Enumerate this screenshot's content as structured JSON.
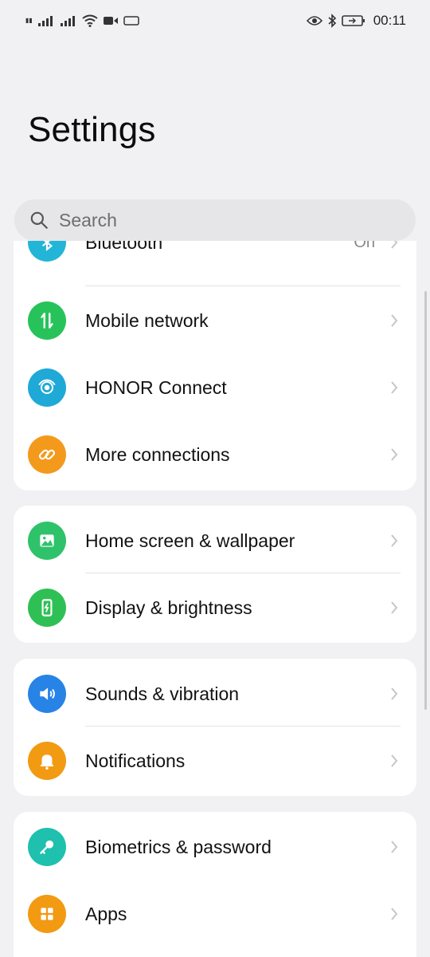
{
  "status_bar": {
    "time": "00:11"
  },
  "page": {
    "title": "Settings"
  },
  "search": {
    "placeholder": "Search"
  },
  "groups": [
    {
      "items": [
        {
          "label": "Bluetooth",
          "value": "On",
          "icon": "bluetooth-icon",
          "color": "#22b5d8"
        },
        {
          "label": "Mobile network",
          "icon": "mobile-data-icon",
          "color": "#27c35a"
        },
        {
          "label": "HONOR Connect",
          "icon": "connect-icon",
          "color": "#1fa9d6"
        },
        {
          "label": "More connections",
          "icon": "link-icon",
          "color": "#f39a1c"
        }
      ]
    },
    {
      "items": [
        {
          "label": "Home screen & wallpaper",
          "icon": "image-icon",
          "color": "#2ec36a"
        },
        {
          "label": "Display & brightness",
          "icon": "phone-brightness-icon",
          "color": "#2fc055"
        }
      ]
    },
    {
      "items": [
        {
          "label": "Sounds & vibration",
          "icon": "speaker-icon",
          "color": "#2783e6"
        },
        {
          "label": "Notifications",
          "icon": "bell-icon",
          "color": "#f29a12"
        }
      ]
    },
    {
      "items": [
        {
          "label": "Biometrics & password",
          "icon": "key-icon",
          "color": "#1fc0ae"
        },
        {
          "label": "Apps",
          "icon": "apps-grid-icon",
          "color": "#f29a12"
        }
      ]
    }
  ]
}
